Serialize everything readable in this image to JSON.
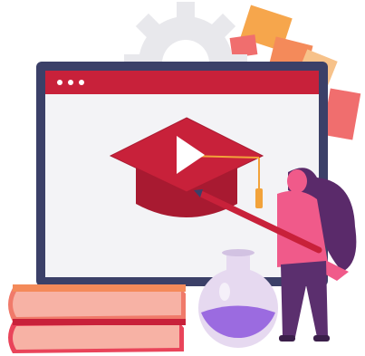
{
  "illustration": {
    "palette": {
      "background": "#ffffff",
      "gear": "#e8e8ec",
      "monitor_frame": "#3b4068",
      "screen": "#f3f3f6",
      "title_bar": "#c8213a",
      "cap": "#c8213a",
      "cap_dark": "#a81a31",
      "tassel": "#f2a23a",
      "play_triangle": "#ffffff",
      "books_top": "#f07a6a",
      "books_bottom": "#e9445a",
      "book_pages": "#f7b2a5",
      "flask_glass": "#e6d9f0",
      "flask_liquid": "#9b6be0",
      "woman_hair": "#5a2a6a",
      "woman_top": "#f05a8a",
      "woman_pants": "#5b2f6e",
      "pencil": "#c8213a",
      "tiles": [
        "#f6a64c",
        "#f48a5a",
        "#f06e6e",
        "#f7c28a"
      ]
    },
    "icons": {
      "gear": "gear-icon",
      "window_dots": "window-dots-icon",
      "cap": "graduation-cap-icon",
      "play": "play-icon",
      "books": "books-icon",
      "flask": "flask-icon",
      "woman": "woman-teacher-figure",
      "pencil": "pencil-icon"
    }
  }
}
